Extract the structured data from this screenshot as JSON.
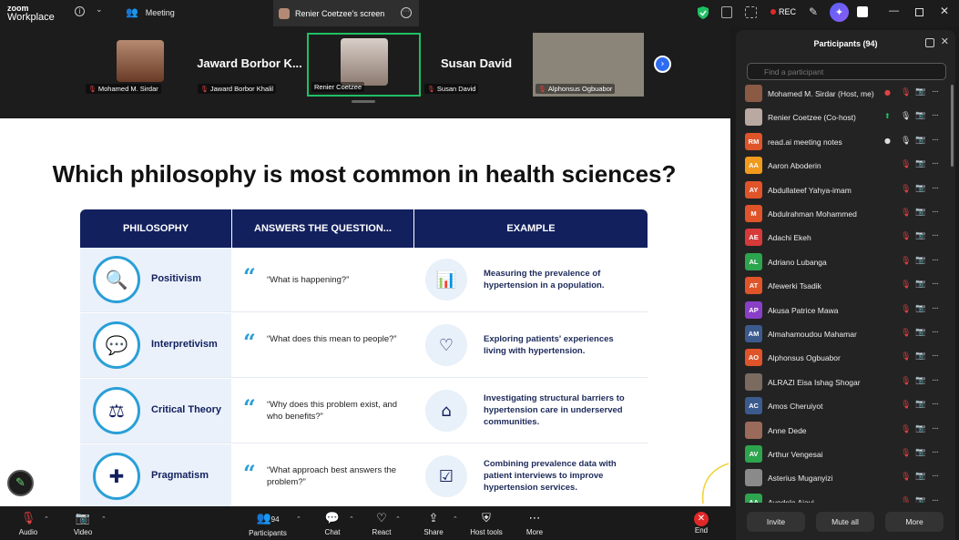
{
  "app": {
    "logo_line1": "zoom",
    "logo_line2": "Workplace"
  },
  "titlebar": {
    "meeting_label": "Meeting",
    "screen_tab_label": "Renier Coetzee's screen",
    "rec_label": "REC"
  },
  "strip": {
    "tiles": [
      {
        "label": "Mohamed M. Sirdar"
      },
      {
        "big_name": "Jaward Borbor K...",
        "label": "Jaward Borbor Khalil"
      },
      {
        "label": "Renier Coetzee"
      },
      {
        "big_name": "Susan David",
        "label": "Susan David"
      },
      {
        "label": "Alphonsus Ogbuabor"
      }
    ]
  },
  "slide": {
    "title": "Which philosophy is most common in health sciences?",
    "headers": [
      "PHILOSOPHY",
      "ANSWERS THE QUESTION...",
      "EXAMPLE"
    ],
    "rows": [
      {
        "name": "Positivism",
        "question": "“What is happening?”",
        "example": "Measuring the prevalence of hypertension in a population."
      },
      {
        "name": "Interpretivism",
        "question": "“What does this mean to people?”",
        "example": "Exploring patients' experiences living with hypertension."
      },
      {
        "name": "Critical Theory",
        "question": "“Why does this problem exist, and who benefits?”",
        "example": "Investigating structural barriers to hypertension care in underserved communities."
      },
      {
        "name": "Pragmatism",
        "question": "“What approach best answers the problem?”",
        "example": "Combining prevalence data with patient interviews to improve hypertension services."
      }
    ],
    "quote_mark": "“"
  },
  "panel": {
    "title": "Participants (94)",
    "search_placeholder": "Find a participant",
    "participants": [
      {
        "initials": "",
        "name": "Mohamed M. Sirdar (Host, me)",
        "color": "#8a5a45",
        "mic": "muted",
        "cam": "off"
      },
      {
        "initials": "",
        "name": "Renier Coetzee (Co-host)",
        "color": "#b9a9a0",
        "mic": "on",
        "cam": "off"
      },
      {
        "initials": "RM",
        "name": "read.ai meeting notes",
        "color": "#e0542a",
        "mic": "on",
        "cam": "off"
      },
      {
        "initials": "AA",
        "name": "Aaron Aboderin",
        "color": "#f09a1e",
        "mic": "muted",
        "cam": "off"
      },
      {
        "initials": "AY",
        "name": "Abdullateef Yahya-imam",
        "color": "#e0542a",
        "mic": "muted",
        "cam": "off"
      },
      {
        "initials": "M",
        "name": "Abdulrahman Mohammed",
        "color": "#e0542a",
        "mic": "muted",
        "cam": "off"
      },
      {
        "initials": "AE",
        "name": "Adachi Ekeh",
        "color": "#d63a3a",
        "mic": "muted",
        "cam": "off"
      },
      {
        "initials": "AL",
        "name": "Adriano Lubanga",
        "color": "#2da44e",
        "mic": "muted",
        "cam": "off"
      },
      {
        "initials": "AT",
        "name": "Afewerki Tsadik",
        "color": "#e0542a",
        "mic": "muted",
        "cam": "off"
      },
      {
        "initials": "AP",
        "name": "Akusa Patrice Mawa",
        "color": "#8a3fc7",
        "mic": "muted",
        "cam": "off"
      },
      {
        "initials": "AM",
        "name": "Almahamoudou Mahamar",
        "color": "#3b5b8f",
        "mic": "muted",
        "cam": "off"
      },
      {
        "initials": "AO",
        "name": "Alphonsus Ogbuabor",
        "color": "#e0542a",
        "mic": "muted",
        "cam": "on"
      },
      {
        "initials": "",
        "name": "ALRAZI Eisa Ishag Shogar",
        "color": "#7a6a60",
        "mic": "muted",
        "cam": "off"
      },
      {
        "initials": "AC",
        "name": "Amos Cheruiyot",
        "color": "#3b5b8f",
        "mic": "muted",
        "cam": "off"
      },
      {
        "initials": "",
        "name": "Anne Dede",
        "color": "#9a6a5a",
        "mic": "muted",
        "cam": "off"
      },
      {
        "initials": "AV",
        "name": "Arthur Vengesai",
        "color": "#2da44e",
        "mic": "muted",
        "cam": "off"
      },
      {
        "initials": "",
        "name": "Asterius Muganyizi",
        "color": "#8a8a8a",
        "mic": "muted",
        "cam": "off"
      },
      {
        "initials": "AA",
        "name": "Ayodele Ajayi",
        "color": "#2da44e",
        "mic": "muted",
        "cam": "off"
      }
    ],
    "buttons": {
      "invite": "Invite",
      "mute_all": "Mute all",
      "more": "More"
    }
  },
  "toolbar": {
    "audio": "Audio",
    "video": "Video",
    "participants": "Participants",
    "participants_count": "94",
    "chat": "Chat",
    "react": "React",
    "share": "Share",
    "host_tools": "Host tools",
    "more": "More",
    "end": "End"
  },
  "colors": {
    "accent": "#2d6cf0",
    "active_speaker": "#1fc064",
    "slide_header": "#12205e",
    "slide_accent": "#2a9fd8",
    "end_red": "#e02828",
    "mute_red": "#e14343"
  }
}
